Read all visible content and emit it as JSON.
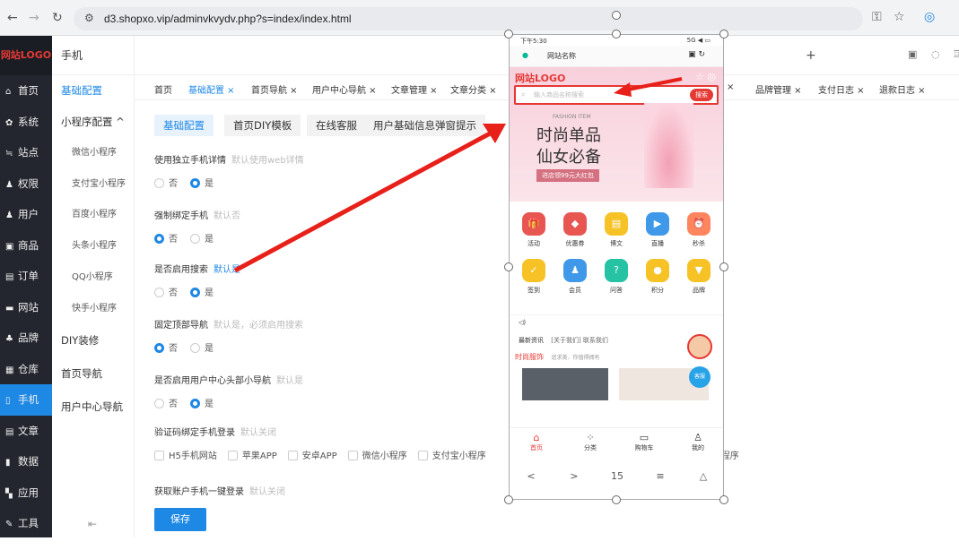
{
  "browser": {
    "url": "d3.shopxo.vip/adminvkvydv.php?s=index/index.html"
  },
  "sidebar": {
    "logo": "网站LOGO",
    "items": [
      {
        "icon": "home-icon",
        "glyph": "⌂",
        "label": "首页"
      },
      {
        "icon": "gear-icon",
        "glyph": "✿",
        "label": "系统"
      },
      {
        "icon": "sites-icon",
        "glyph": "≒",
        "label": "站点"
      },
      {
        "icon": "permission-icon",
        "glyph": "♟",
        "label": "权限"
      },
      {
        "icon": "user-icon",
        "glyph": "♟",
        "label": "用户"
      },
      {
        "icon": "goods-icon",
        "glyph": "▣",
        "label": "商品"
      },
      {
        "icon": "order-icon",
        "glyph": "▤",
        "label": "订单"
      },
      {
        "icon": "website-icon",
        "glyph": "▬",
        "label": "网站"
      },
      {
        "icon": "brand-icon",
        "glyph": "♣",
        "label": "品牌"
      },
      {
        "icon": "warehouse-icon",
        "glyph": "▦",
        "label": "仓库"
      },
      {
        "icon": "mobile-icon",
        "glyph": "▯",
        "label": "手机"
      },
      {
        "icon": "article-icon",
        "glyph": "▤",
        "label": "文章"
      },
      {
        "icon": "data-icon",
        "glyph": "▮",
        "label": "数据"
      },
      {
        "icon": "apps-icon",
        "glyph": "▚",
        "label": "应用"
      },
      {
        "icon": "tools-icon",
        "glyph": "✎",
        "label": "工具"
      }
    ]
  },
  "submenu": {
    "title": "手机",
    "basic": "基础配置",
    "miniprogram": "小程序配置 ^",
    "programs": [
      "微信小程序",
      "支付宝小程序",
      "百度小程序",
      "头条小程序",
      "QQ小程序",
      "快手小程序"
    ],
    "diy": "DIY装修",
    "home_nav": "首页导航",
    "user_nav": "用户中心导航"
  },
  "tabs": [
    "首页",
    "基础配置 ×",
    "首页导航 ×",
    "用户中心导航 ×",
    "文章管理 ×",
    "文章分类 ×",
    "× ",
    "品牌管理 ×",
    "支付日志 ×",
    "退款日志 ×"
  ],
  "subtabs": [
    "基础配置",
    "首页DIY模板",
    "在线客服",
    "用户基础信息弹窗提示"
  ],
  "fields": [
    {
      "label": "使用独立手机详情",
      "hint": "默认使用web详情",
      "opts": [
        "否",
        "是"
      ],
      "sel": 1
    },
    {
      "label": "强制绑定手机",
      "hint": "默认否",
      "opts": [
        "否",
        "是"
      ],
      "sel": 0
    },
    {
      "label": "是否启用搜索",
      "hint": "默认是",
      "opts": [
        "否",
        "是"
      ],
      "sel": 1
    },
    {
      "label": "固定顶部导航",
      "hint": "默认是，必须启用搜索",
      "opts": [
        "否",
        "是"
      ],
      "sel": 0
    },
    {
      "label": "是否启用用户中心头部小导航",
      "hint": "默认是",
      "opts": [
        "否",
        "是"
      ],
      "sel": 1
    }
  ],
  "verify": {
    "label": "验证码绑定手机登录",
    "hint": "默认关闭",
    "opts": [
      "H5手机网站",
      "苹果APP",
      "安卓APP",
      "微信小程序",
      "支付宝小程序"
    ],
    "tail": "小程序"
  },
  "onekey": {
    "label": "获取账户手机一键登录",
    "hint": "默认关闭"
  },
  "save": "保存",
  "phone": {
    "time": "下午5:30",
    "status": "5G ◀ ▭",
    "sitename": "网站名称",
    "logo": "网站LOGO",
    "search_placeholder": "输入商品名称搜索",
    "search_btn": "搜索",
    "banner_tag": "FASHION ITEM",
    "banner_t1": "时尚单品",
    "banner_t2": "仙女必备",
    "banner_btn": "进店领99元大红包",
    "icons": [
      {
        "l": "活动",
        "c": "#e53935",
        "g": "🎁"
      },
      {
        "l": "优惠券",
        "c": "#e53935",
        "g": "◆"
      },
      {
        "l": "博文",
        "c": "#f5b800",
        "g": "▤"
      },
      {
        "l": "直播",
        "c": "#1e88e5",
        "g": "▶"
      },
      {
        "l": "秒杀",
        "c": "#ff7043",
        "g": "⏰"
      },
      {
        "l": "签到",
        "c": "#f5b800",
        "g": "✓"
      },
      {
        "l": "会员",
        "c": "#1e88e5",
        "g": "♟"
      },
      {
        "l": "问答",
        "c": "#00b894",
        "g": "?"
      },
      {
        "l": "积分",
        "c": "#f5b800",
        "g": "●"
      },
      {
        "l": "品牌",
        "c": "#f5b800",
        "g": "▼"
      }
    ],
    "notice": "◁)",
    "news_label": "最新资讯",
    "news_text": "[关于我们] 联系我们",
    "cat_title": "时尚服饰",
    "cat_sub": "追求美、你值得拥有",
    "bottom": [
      {
        "l": "首页",
        "g": "⌂"
      },
      {
        "l": "分类",
        "g": "⁘"
      },
      {
        "l": "购物车",
        "g": "▭"
      },
      {
        "l": "我的",
        "g": "♙"
      }
    ],
    "sysnav": [
      "<",
      ">",
      "15",
      "≡",
      "△"
    ],
    "service": "客服"
  },
  "colors": {
    "accent": "#1e88e5",
    "red": "#e53935",
    "sidebar": "#23262e"
  }
}
